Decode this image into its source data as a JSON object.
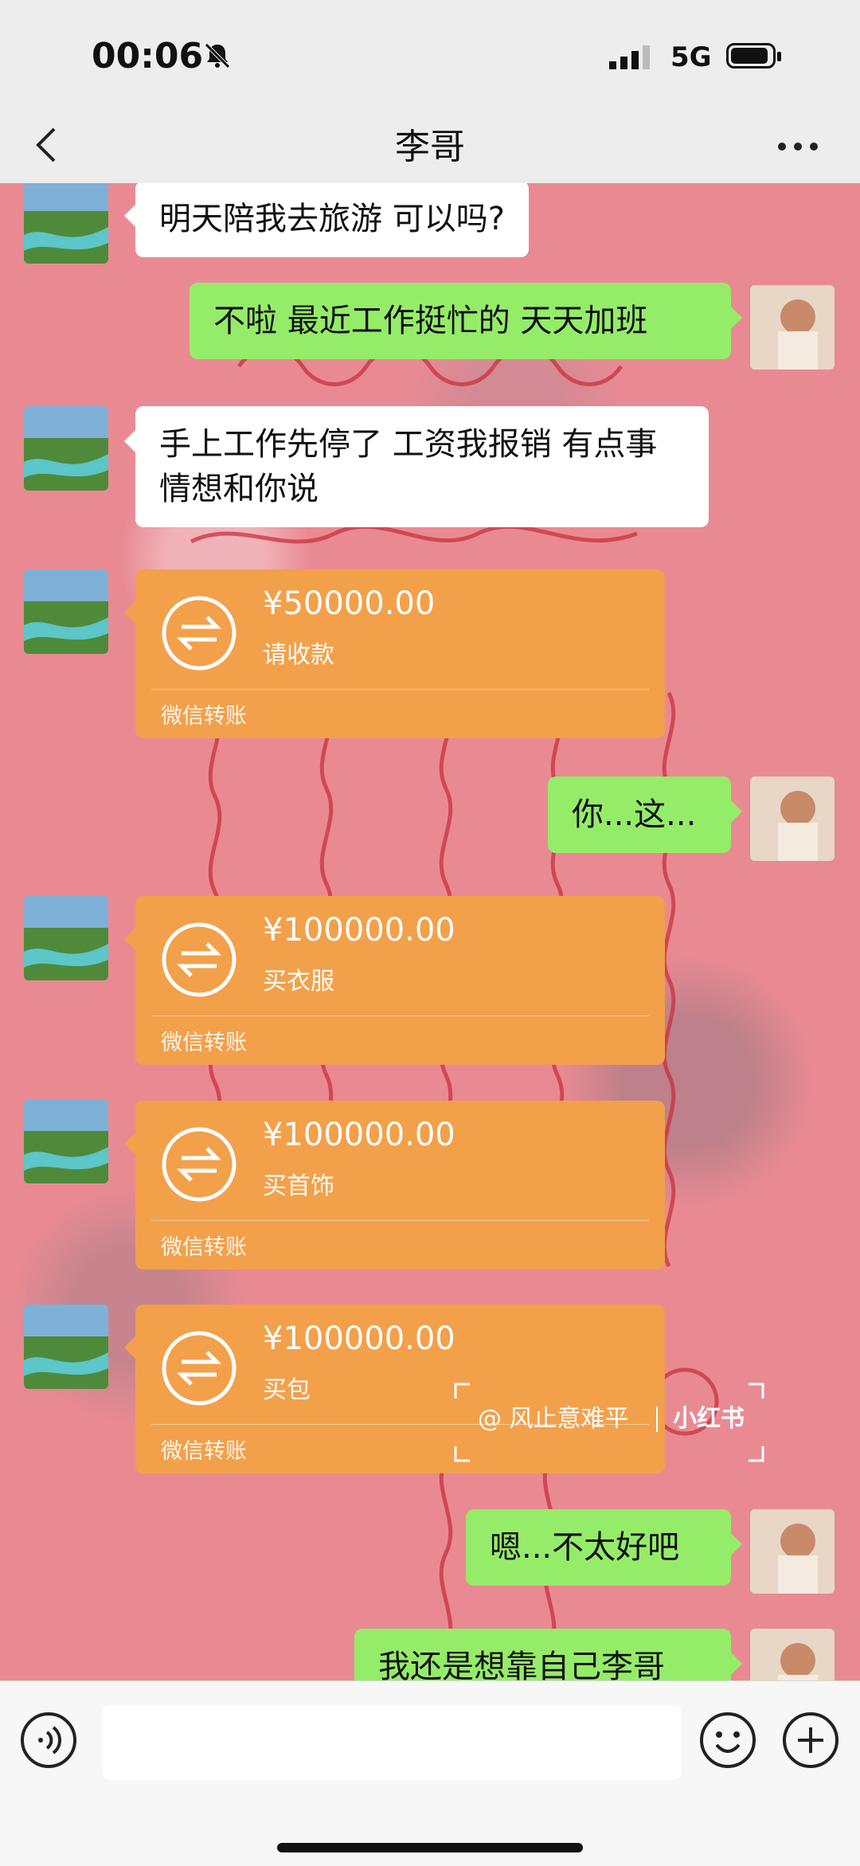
{
  "status_bar": {
    "time": "00:06",
    "network": "5G",
    "icons": [
      "bell-off-icon",
      "signal-icon",
      "battery-icon"
    ]
  },
  "header": {
    "title": "李哥",
    "back_icon": "chevron-left-icon",
    "more_icon": "more-icon"
  },
  "messages": [
    {
      "side": "left",
      "type": "text",
      "text": "明天陪我去旅游 可以吗?"
    },
    {
      "side": "right",
      "type": "text",
      "text": "不啦 最近工作挺忙的 天天加班"
    },
    {
      "side": "left",
      "type": "text",
      "text": "手上工作先停了 工资我报销 有点事情想和你说"
    },
    {
      "side": "left",
      "type": "transfer",
      "amount": "¥50000.00",
      "note": "请收款",
      "label": "微信转账"
    },
    {
      "side": "right",
      "type": "text",
      "text": "你...这..."
    },
    {
      "side": "left",
      "type": "transfer",
      "amount": "¥100000.00",
      "note": "买衣服",
      "label": "微信转账"
    },
    {
      "side": "left",
      "type": "transfer",
      "amount": "¥100000.00",
      "note": "买首饰",
      "label": "微信转账"
    },
    {
      "side": "left",
      "type": "transfer",
      "amount": "¥100000.00",
      "note": "买包",
      "label": "微信转账"
    },
    {
      "side": "right",
      "type": "text",
      "text": "嗯...不太好吧"
    },
    {
      "side": "right",
      "type": "text",
      "text": "我还是想靠自己李哥"
    }
  ],
  "watermark": {
    "user": "@ 风止意难平",
    "logo": "小红书"
  },
  "input_bar": {
    "placeholder": "",
    "icons": [
      "voice-icon",
      "emoji-icon",
      "plus-icon"
    ]
  },
  "colors": {
    "chat_bg": "#e98a93",
    "bubble_right": "#95ec69",
    "bubble_left": "#ffffff",
    "transfer": "#f3a04a",
    "bar_bg": "#ededed"
  }
}
